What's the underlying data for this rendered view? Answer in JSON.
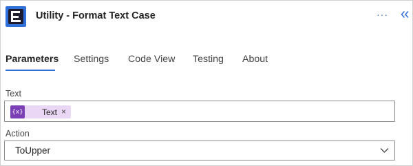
{
  "header": {
    "title": "Utility - Format Text Case",
    "more_label": "···",
    "app_icon": "text-utility-icon",
    "collapse_icon": "double-chevron-left-icon"
  },
  "tabs": [
    {
      "label": "Parameters",
      "active": true
    },
    {
      "label": "Settings",
      "active": false
    },
    {
      "label": "Code View",
      "active": false
    },
    {
      "label": "Testing",
      "active": false
    },
    {
      "label": "About",
      "active": false
    }
  ],
  "fields": {
    "text": {
      "label": "Text",
      "token": {
        "icon_text": "{x}",
        "label": "Text",
        "remove": "×",
        "icon": "variable-icon"
      }
    },
    "action": {
      "label": "Action",
      "value": "ToUpper",
      "icon": "chevron-down-icon"
    }
  },
  "colors": {
    "accent": "#2f6fdc",
    "token_bg": "#ead7f5",
    "token_icon_bg": "#7b3fb6"
  }
}
